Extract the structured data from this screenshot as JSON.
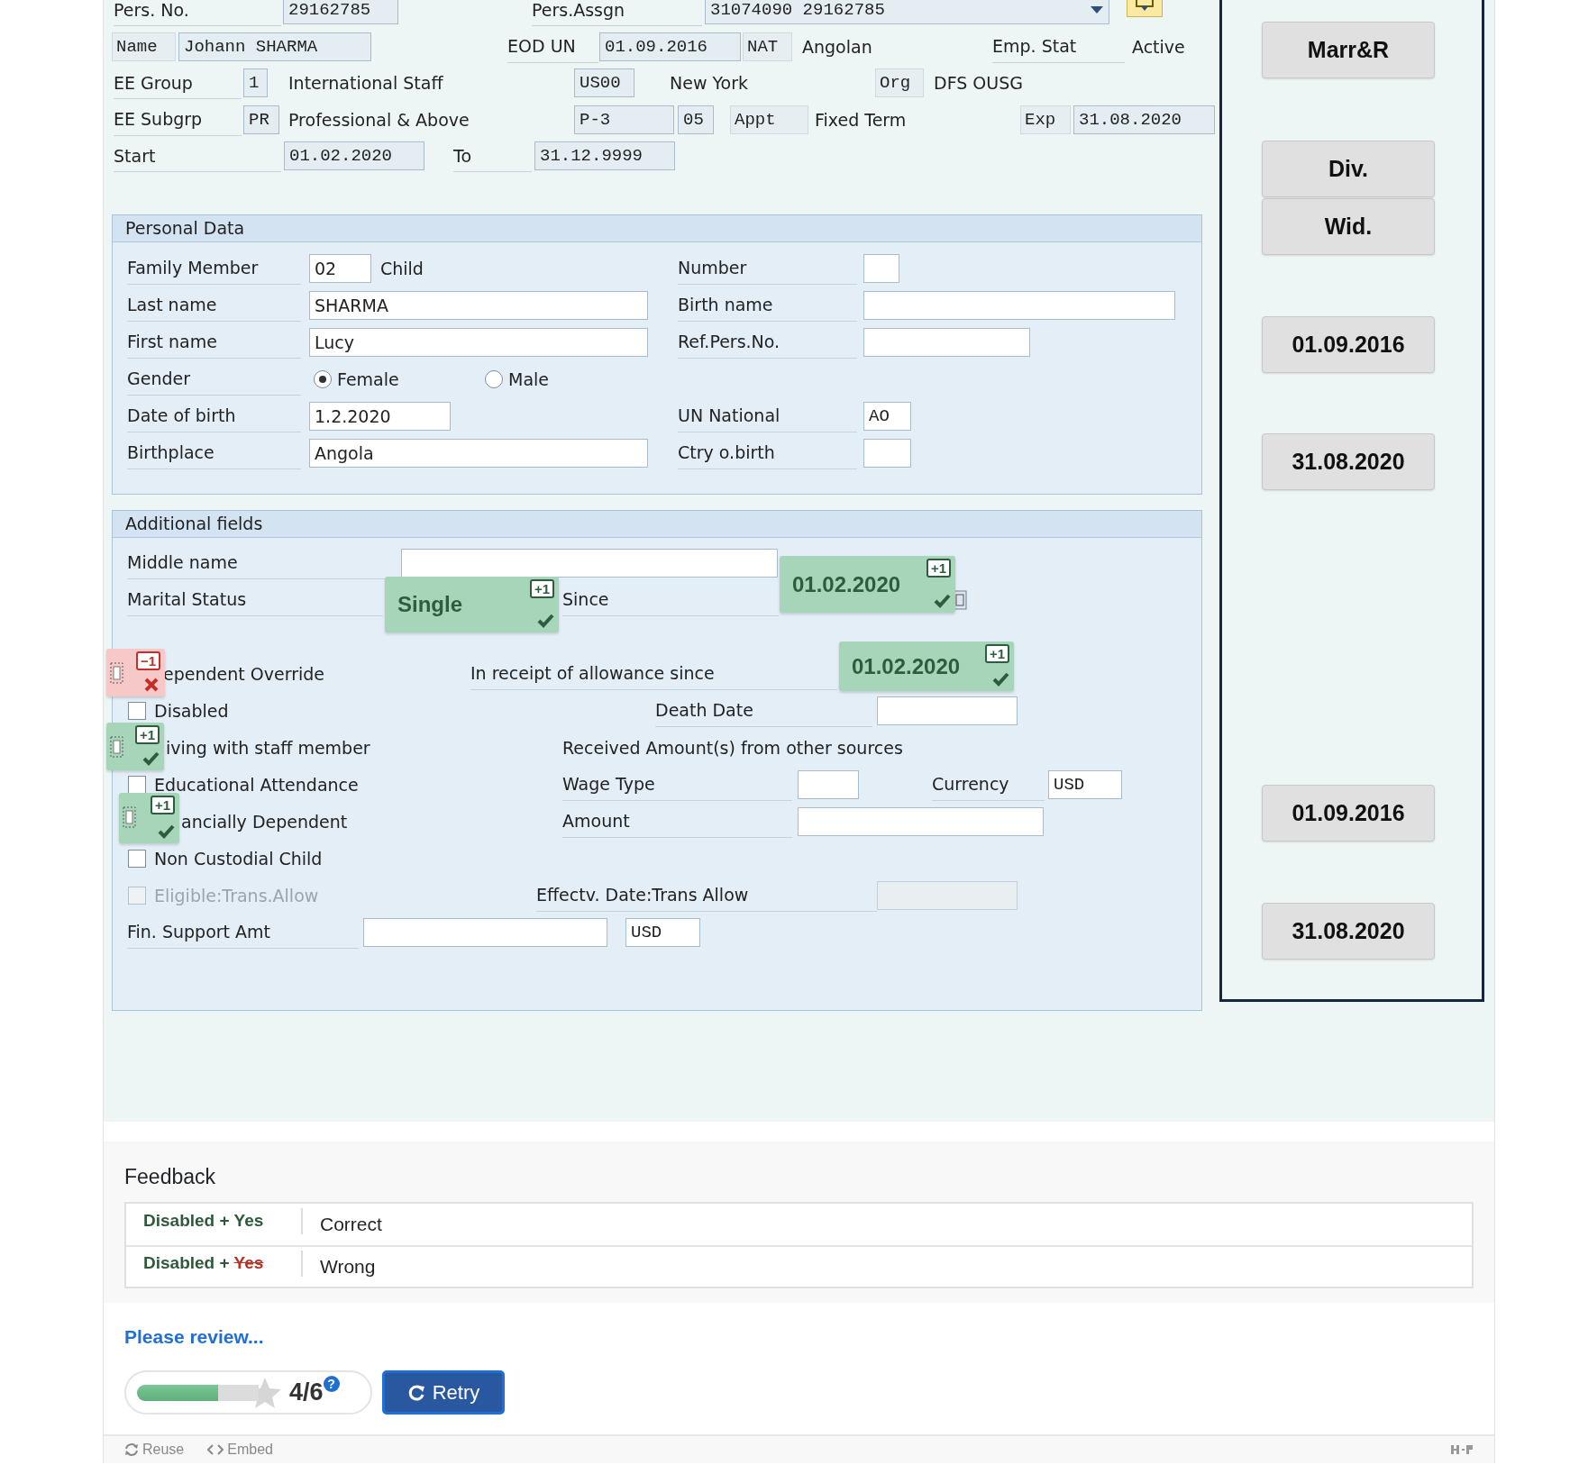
{
  "header": {
    "pers_no": {
      "label": "Pers. No.",
      "value": "29162785"
    },
    "pers_assgn": {
      "label": "Pers.Assgn",
      "value": "31074090 29162785"
    },
    "name": {
      "label": "Name",
      "value": "Johann SHARMA"
    },
    "eod_un": {
      "label": "EOD UN",
      "value": "01.09.2016"
    },
    "nat": {
      "label": "NAT",
      "value": "Angolan"
    },
    "emp_stat": {
      "label": "Emp. Stat",
      "value": "Active"
    },
    "ee_group": {
      "label": "EE Group",
      "code": "1",
      "text": "International Staff"
    },
    "location": {
      "code": "US00",
      "text": "New York"
    },
    "org": {
      "label": "Org",
      "value": "DFS OUSG"
    },
    "ee_subgrp": {
      "label": "EE Subgrp",
      "code": "PR",
      "text": "Professional & Above"
    },
    "grade": {
      "code": "P-3",
      "step": "05"
    },
    "appt": {
      "label": "Appt",
      "value": "Fixed Term"
    },
    "exp": {
      "label": "Exp",
      "value": "31.08.2020"
    },
    "start": {
      "label": "Start",
      "value": "01.02.2020"
    },
    "to": {
      "label": "To",
      "value": "31.12.9999"
    }
  },
  "personal_data": {
    "title": "Personal Data",
    "rows": [
      {
        "label": "Family Member",
        "value": "02",
        "note": "Child",
        "right_label": "Number"
      },
      {
        "label": "Last name",
        "value": "SHARMA",
        "right_label": "Birth name"
      },
      {
        "label": "First name",
        "value": "Lucy",
        "right_label": "Ref.Pers.No."
      },
      {
        "label": "Gender",
        "options": [
          {
            "label": "Female",
            "selected": true
          },
          {
            "label": "Male",
            "selected": false
          }
        ]
      },
      {
        "label": "Date of birth",
        "value": "1.2.2020",
        "right_label": "UN National",
        "right_value": "AO"
      },
      {
        "label": "Birthplace",
        "value": "Angola",
        "right_label": "Ctry o.birth"
      }
    ]
  },
  "additional_fields": {
    "title": "Additional fields",
    "rows": [
      [
        {
          "kind": "label",
          "text": "Middle name"
        },
        {
          "kind": "field"
        }
      ],
      [
        {
          "kind": "label",
          "text": "Marital Status"
        },
        {
          "kind": "label",
          "text": "Since"
        },
        {
          "kind": "calendar-icon"
        }
      ],
      [],
      [
        {
          "kind": "text",
          "text": "ependent Override"
        },
        {
          "kind": "label",
          "text": "In receipt of allowance since"
        }
      ],
      [
        {
          "kind": "checkbox",
          "label": "Disabled",
          "checked": false,
          "disabled": false
        },
        {
          "kind": "label",
          "text": "Death Date"
        },
        {
          "kind": "field"
        }
      ],
      [
        {
          "kind": "text",
          "text": "iving with staff member"
        },
        {
          "kind": "text",
          "text": "Received Amount(s) from other sources"
        }
      ],
      [
        {
          "kind": "checkbox",
          "label": "Educational Attendance",
          "checked": false,
          "disabled": false
        },
        {
          "kind": "label",
          "text": "Wage Type"
        },
        {
          "kind": "field"
        },
        {
          "kind": "label",
          "text": "Currency"
        },
        {
          "kind": "field",
          "value": "USD"
        }
      ],
      [
        {
          "kind": "text",
          "text": "ancially Dependent"
        },
        {
          "kind": "label",
          "text": "Amount"
        },
        {
          "kind": "field"
        }
      ],
      [
        {
          "kind": "checkbox",
          "label": "Non Custodial Child",
          "checked": false,
          "disabled": false
        }
      ],
      [
        {
          "kind": "checkbox",
          "label": "Eligible:Trans.Allow",
          "checked": false,
          "disabled": true
        },
        {
          "kind": "label",
          "text": "Effectv. Date:Trans Allow"
        },
        {
          "kind": "field",
          "disabled": true
        }
      ],
      [
        {
          "kind": "label",
          "text": "Fin. Support Amt"
        },
        {
          "kind": "field"
        },
        {
          "kind": "field",
          "value": "USD"
        }
      ]
    ]
  },
  "drop_items": [
    {
      "kind": "text",
      "text": "Single",
      "correct": true,
      "score": "+1"
    },
    {
      "kind": "text",
      "text": "01.02.2020",
      "correct": true,
      "score": "+1"
    },
    {
      "kind": "checkbox",
      "correct": false,
      "score": "−1"
    },
    {
      "kind": "text",
      "text": "01.02.2020",
      "correct": true,
      "score": "+1"
    },
    {
      "kind": "checkbox",
      "correct": true,
      "score": "+1"
    },
    {
      "kind": "checkbox",
      "correct": true,
      "score": "+1"
    }
  ],
  "side_buttons": [
    "Marr&R",
    "Div.",
    "Wid.",
    "01.09.2016",
    "31.08.2020",
    "01.09.2016",
    "31.08.2020"
  ],
  "feedback": {
    "title": "Feedback",
    "rows": [
      {
        "label": "Disabled +",
        "answer": "Yes",
        "correct": true,
        "result": "Correct"
      },
      {
        "label": "Disabled +",
        "answer": "Yes",
        "correct": false,
        "result": "Wrong"
      }
    ]
  },
  "review_link": "Please review...",
  "score": {
    "level": 0.667,
    "text": "4/6",
    "help": "?"
  },
  "retry_button": "Retry",
  "footer": {
    "links": [
      {
        "kind": "reuse",
        "text": "Reuse"
      },
      {
        "kind": "embed",
        "text": "Embed"
      }
    ]
  }
}
